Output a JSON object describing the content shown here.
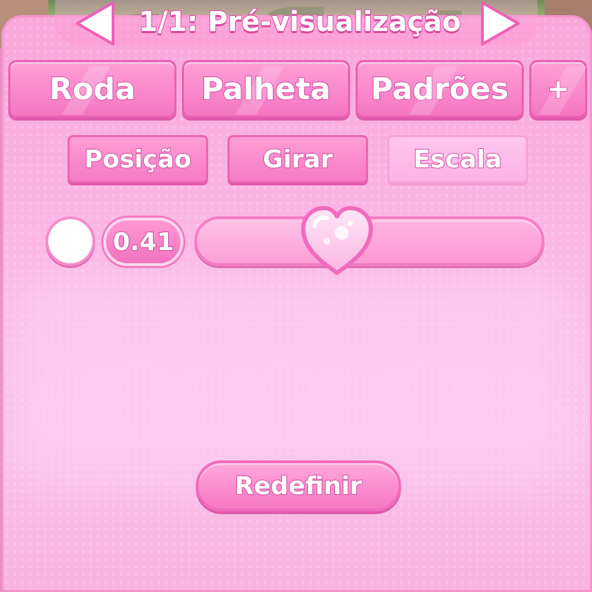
{
  "header": {
    "title": "1/1: Pré-visualização",
    "prev_icon": "triangle-left-icon",
    "next_icon": "triangle-right-icon"
  },
  "tabs": [
    {
      "label": "Roda"
    },
    {
      "label": "Palheta"
    },
    {
      "label": "Padrões"
    },
    {
      "label": "+"
    }
  ],
  "subtabs": [
    {
      "label": "Posição",
      "selected": false
    },
    {
      "label": "Girar",
      "selected": false
    },
    {
      "label": "Escala",
      "selected": true
    }
  ],
  "scale_control": {
    "color_swatch": "#ffffff",
    "value_text": "0.41",
    "slider_level": 0.41,
    "thumb_icon": "heart-icon"
  },
  "reset_button": {
    "label": "Redefinir"
  },
  "colors": {
    "primary_pink": "#f576c2",
    "light_pink": "#fcc4ee",
    "outline_pink": "#d24a9e"
  }
}
